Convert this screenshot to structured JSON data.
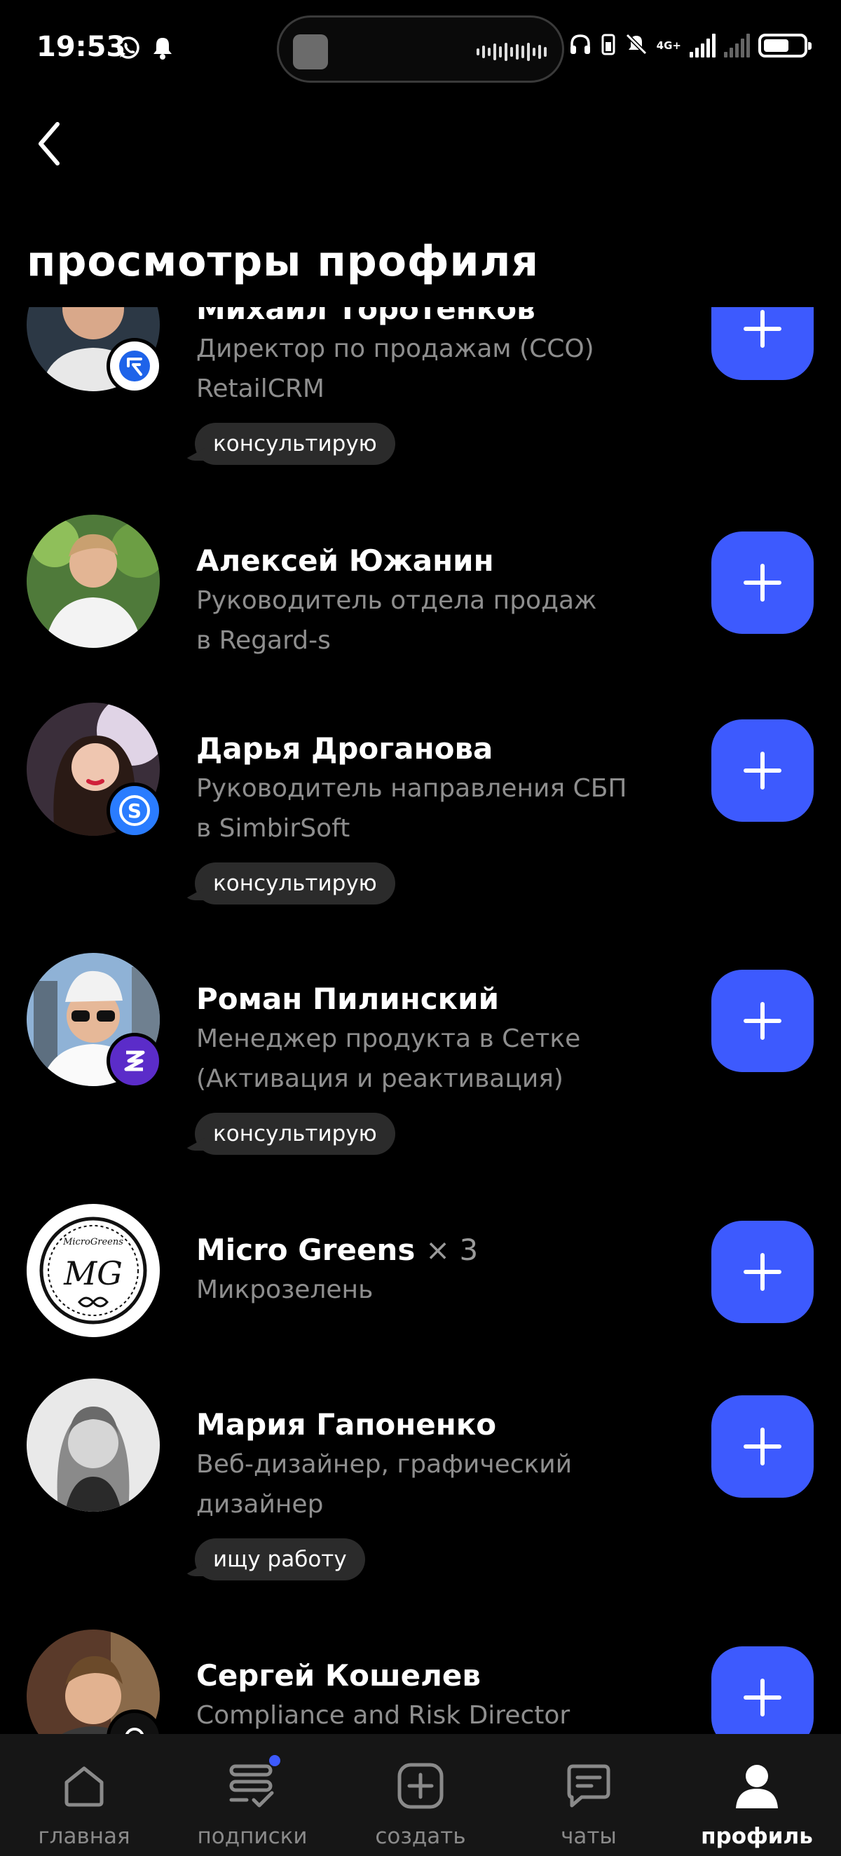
{
  "status_bar": {
    "time": "19:53",
    "network_label": "4G+",
    "battery_level": 0.65
  },
  "header": {
    "title": "просмотры профиля"
  },
  "people": [
    {
      "name": "Михаил Торотенков",
      "role_lines": [
        "Директор по продажам (CCO)",
        "RetailCRM"
      ],
      "tag": "консультирую",
      "badge": "retailcrm-logo"
    },
    {
      "name": "Алексей Южанин",
      "role_lines": [
        "Руководитель отдела продаж",
        "в Regard-s"
      ],
      "tag": null,
      "badge": null
    },
    {
      "name": "Дарья Дроганова",
      "role_lines": [
        "Руководитель направления СБП",
        "в SimbirSoft"
      ],
      "tag": "консультирую",
      "badge": "simbirsoft-logo"
    },
    {
      "name": "Роман Пилинский",
      "role_lines": [
        "Менеджер продукта в Сетке",
        "(Активация и реактивация)"
      ],
      "tag": "консультирую",
      "badge": "setka-logo"
    },
    {
      "name": "Micro Greens",
      "count": "× 3",
      "role_lines": [
        "Микрозелень"
      ],
      "tag": null,
      "badge": null
    },
    {
      "name": "Мария Гапоненко",
      "role_lines": [
        "Веб-дизайнер, графический",
        "дизайнер"
      ],
      "tag": "ищу работу",
      "badge": null
    },
    {
      "name": "Сергей Кошелев",
      "role_lines": [
        "Compliance and Risk Director"
      ],
      "tag": null,
      "badge": "company-logo"
    }
  ],
  "bottom_nav": [
    {
      "label": "главная",
      "icon": "home-icon"
    },
    {
      "label": "подписки",
      "icon": "subscriptions-icon"
    },
    {
      "label": "создать",
      "icon": "create-icon"
    },
    {
      "label": "чаты",
      "icon": "chat-icon"
    },
    {
      "label": "профиль",
      "icon": "profile-icon"
    }
  ],
  "colors": {
    "accent": "#3d5afe",
    "background": "#000000",
    "secondary_text": "#8e8e8e",
    "tag_background": "#2b2b2b"
  }
}
